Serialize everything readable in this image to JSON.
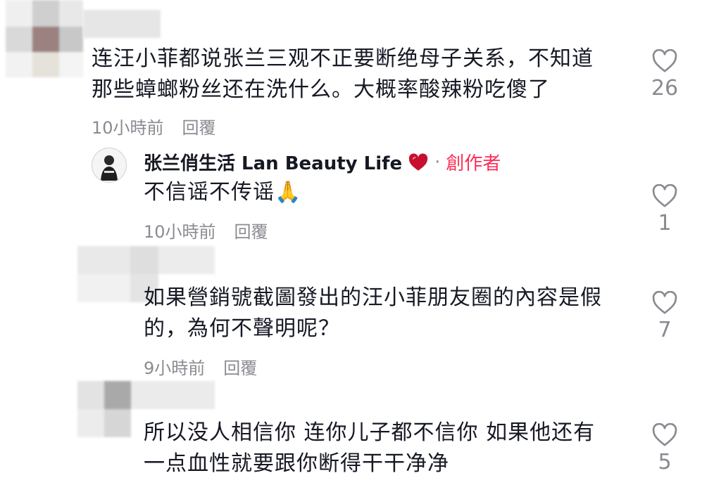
{
  "comments": [
    {
      "text": "连汪小菲都说张兰三观不正要断绝母子关系，不知道\n那些蟑螂粉丝还在洗什么。大概率酸辣粉吃傻了",
      "time": "10小時前",
      "reply_label": "回覆",
      "likes": "26"
    },
    {
      "author": "张兰俏生活 Lan Beauty Life",
      "creator_badge": "創作者",
      "text": "不信谣不传谣🙏",
      "time": "10小時前",
      "reply_label": "回覆",
      "likes": "1"
    },
    {
      "text": "如果營銷號截圖發出的汪小菲朋友圈的內容是假\n的，為何不聲明呢？",
      "time": "9小時前",
      "reply_label": "回覆",
      "likes": "7"
    },
    {
      "text": "所以没人相信你 连你儿子都不信你 如果他还有\n一点血性就要跟你断得干干净净",
      "likes": "5"
    }
  ],
  "colors": {
    "text": "#161823",
    "muted": "#8a8b91",
    "creator": "#fe2c55",
    "heart_badge": "#c8102e"
  }
}
